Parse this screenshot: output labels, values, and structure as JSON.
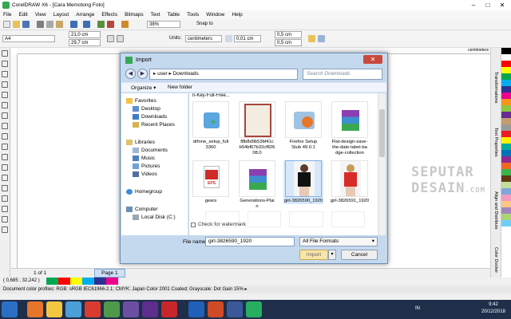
{
  "window": {
    "title": "CorelDRAW X6 - [Cara Memotong Foto]"
  },
  "menu": [
    "File",
    "Edit",
    "View",
    "Layout",
    "Arrange",
    "Effects",
    "Bitmaps",
    "Text",
    "Table",
    "Tools",
    "Window",
    "Help"
  ],
  "toolbar": {
    "zoom": "38%",
    "snap": "Snap to",
    "page_size": "A4",
    "width": "21,0 cm",
    "height": "29,7 cm",
    "units_label": "Units:",
    "units": "centimeters",
    "nudge": "0,01 cm",
    "dup_x": "0,5 cm",
    "dup_y": "0,5 cm"
  },
  "ruler": {
    "unit": "centimeters"
  },
  "dialog": {
    "title": "Import",
    "path_user": "user",
    "path_folder": "Downloads",
    "search_placeholder": "Search Downloads",
    "organize": "Organize ▾",
    "new_folder": "New folder",
    "nav": {
      "favorites": "Favorites",
      "desktop": "Desktop",
      "downloads": "Downloads",
      "recent": "Recent Places",
      "libraries": "Libraries",
      "documents": "Documents",
      "music": "Music",
      "pictures": "Pictures",
      "videos": "Videos",
      "homegroup": "Homegroup",
      "computer": "Computer",
      "local_disk": "Local Disk (C:)"
    },
    "partial_top_label": "n-Key-Full-Free...",
    "files": [
      {
        "name": "drfone_setup_full\n3360"
      },
      {
        "name": "f8b8d9b53bf41c\nb54bf67b32cf826\n08.0"
      },
      {
        "name": "Firefox Setup\nStub 49.0.1"
      },
      {
        "name": "Flat-design-save-\nthe-date-label-ba\ndge-collection"
      },
      {
        "name": "gears"
      },
      {
        "name": "Generations-Plai\nn"
      },
      {
        "name": "girl-3826590_1920"
      },
      {
        "name": "girl-3826591_1920"
      }
    ],
    "eps_label": "EPS",
    "watermark_check": "Check for watermark",
    "file_name_label": "File name:",
    "file_name": "girl-3826590_1920",
    "file_type": "All File Formats",
    "import_btn": "Import",
    "cancel_btn": "Cancel"
  },
  "watermark": {
    "line1": "SEPUTAR",
    "line2": "DESAIN",
    "suffix": ".COM"
  },
  "pagebar": {
    "page_of": "1 of 1",
    "page_tab": "Page 1"
  },
  "status": {
    "coords": "( 0,685 ; 32,242 )",
    "profiles": "Document color profiles: RGB: sRGB IEC61966-2.1; CMYK: Japan Color 2001 Coated; Grayscale: Dot Gain 15% ▸"
  },
  "dockers": [
    "Transformations",
    "Text Properties",
    "Align and Distribute",
    "Color Docker"
  ],
  "tray": {
    "lang": "IN",
    "time": "9:42",
    "date": "20/12/2018"
  },
  "palette": [
    "#000000",
    "#ffffff",
    "#ff0000",
    "#ffff00",
    "#00a650",
    "#00aeef",
    "#2e3192",
    "#ec008c",
    "#f7941d",
    "#8dc63f",
    "#662d91",
    "#c69c6d",
    "#999999",
    "#ed1c24",
    "#fff200",
    "#00a99d",
    "#0072bc",
    "#92278f",
    "#f26522",
    "#39b54a",
    "#603913",
    "#c4df9b",
    "#7da7d9",
    "#f49ac2",
    "#fdc689",
    "#a186be",
    "#acd373",
    "#6dcff6"
  ]
}
